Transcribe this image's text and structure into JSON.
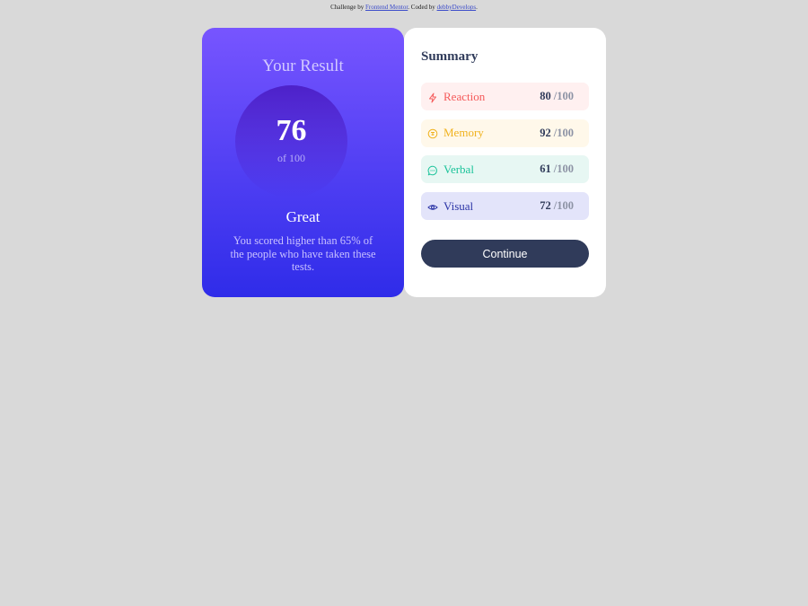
{
  "attribution": {
    "prefix": "Challenge by ",
    "challenge_link": "Frontend Mentor",
    "middle": ". Coded by ",
    "author_link": "debbyDevelops",
    "suffix": "."
  },
  "result": {
    "title": "Your Result",
    "score": "76",
    "of_label": "of 100",
    "grade": "Great",
    "description": "You scored higher than 65% of the people who have taken these tests."
  },
  "summary": {
    "title": "Summary",
    "items": [
      {
        "label": "Reaction",
        "score": "80",
        "max": "/100",
        "icon": "lightning-icon",
        "color": "#f55a5a"
      },
      {
        "label": "Memory",
        "score": "92",
        "max": "/100",
        "icon": "brain-icon",
        "color": "#f0b21e"
      },
      {
        "label": "Verbal",
        "score": "61",
        "max": "/100",
        "icon": "chat-bubble-icon",
        "color": "#1bc39a"
      },
      {
        "label": "Visual",
        "score": "72",
        "max": "/100",
        "icon": "eye-icon",
        "color": "#2b34a6"
      }
    ],
    "button_label": "Continue"
  }
}
